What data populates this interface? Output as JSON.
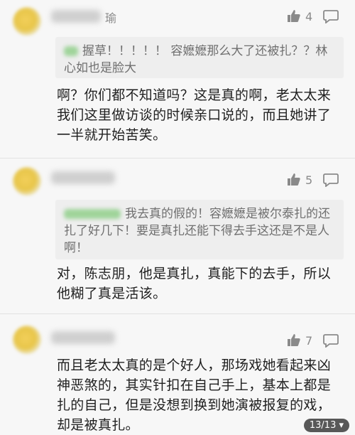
{
  "colors": {
    "background": "#f7f7f7",
    "quote_bg": "#eeeeee",
    "icon_gray": "#8a8a8a"
  },
  "comments": [
    {
      "user_tail": "瑜",
      "likes": "4",
      "quote": "握草！！！！！ 容嬷嬷那么大了还被扎？？林心如也是脸大",
      "text": "啊？你们都不知道吗？这是真的啊，老太太来我们这里做访谈的时候亲口说的，而且她讲了一半就开始苦笑。"
    },
    {
      "user_tail": "",
      "likes": "5",
      "quote": "我去真的假的！容嬷嬷是被尔泰扎的还扎了好几下！要是真扎还能下得去手这还是不是人啊！",
      "text": "对，陈志朋，他是真扎，真能下的去手，所以他糊了真是活该。"
    },
    {
      "user_tail": "",
      "likes": "7",
      "quote": "",
      "text": "而且老太太真的是个好人，那场戏她看起来凶神恶煞的，其实针扣在自己手上，基本上都是扎的自己，但是没想到换到她演被报复的戏，却是被真扎。"
    }
  ],
  "pager": {
    "label": "13/13 ▾"
  },
  "icons": {
    "like": "thumbs-up-icon",
    "reply": "comment-bubble-icon"
  }
}
